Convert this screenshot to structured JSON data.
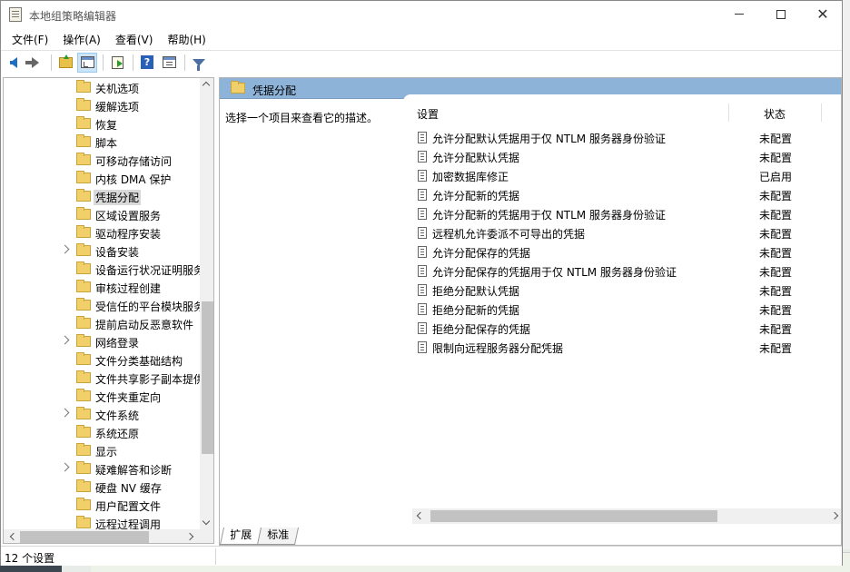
{
  "window": {
    "title": "本地组策略编辑器",
    "min_label": "—",
    "max_label": "☐",
    "close_label": "✕"
  },
  "menu": [
    "文件(F)",
    "操作(A)",
    "查看(V)",
    "帮助(H)"
  ],
  "toolbar": {
    "icons": [
      "back-arrow-icon",
      "forward-arrow-icon",
      "up-folder-icon",
      "show-tree-icon",
      "export-list-icon",
      "help-icon",
      "properties-icon",
      "filter-icon"
    ]
  },
  "tree": {
    "items": [
      {
        "label": "关机选项",
        "expandable": false
      },
      {
        "label": "缓解选项",
        "expandable": false
      },
      {
        "label": "恢复",
        "expandable": false
      },
      {
        "label": "脚本",
        "expandable": false
      },
      {
        "label": "可移动存储访问",
        "expandable": false
      },
      {
        "label": "内核 DMA 保护",
        "expandable": false
      },
      {
        "label": "凭据分配",
        "expandable": false,
        "selected": true
      },
      {
        "label": "区域设置服务",
        "expandable": false
      },
      {
        "label": "驱动程序安装",
        "expandable": false
      },
      {
        "label": "设备安装",
        "expandable": true
      },
      {
        "label": "设备运行状况证明服务",
        "expandable": false
      },
      {
        "label": "审核过程创建",
        "expandable": false
      },
      {
        "label": "受信任的平台模块服务",
        "expandable": false
      },
      {
        "label": "提前启动反恶意软件",
        "expandable": false
      },
      {
        "label": "网络登录",
        "expandable": true
      },
      {
        "label": "文件分类基础结构",
        "expandable": false
      },
      {
        "label": "文件共享影子副本提供程序",
        "expandable": false
      },
      {
        "label": "文件夹重定向",
        "expandable": false
      },
      {
        "label": "文件系统",
        "expandable": true
      },
      {
        "label": "系统还原",
        "expandable": false
      },
      {
        "label": "显示",
        "expandable": false
      },
      {
        "label": "疑难解答和诊断",
        "expandable": true
      },
      {
        "label": "硬盘 NV 缓存",
        "expandable": false
      },
      {
        "label": "用户配置文件",
        "expandable": false
      },
      {
        "label": "远程过程调用",
        "expandable": false
      }
    ]
  },
  "detail": {
    "header_title": "凭据分配",
    "description": "选择一个项目来查看它的描述。",
    "col_setting": "设置",
    "col_status": "状态",
    "rows": [
      {
        "name": "允许分配默认凭据用于仅 NTLM 服务器身份验证",
        "state": "未配置"
      },
      {
        "name": "允许分配默认凭据",
        "state": "未配置"
      },
      {
        "name": "加密数据库修正",
        "state": "已启用"
      },
      {
        "name": "允许分配新的凭据",
        "state": "未配置"
      },
      {
        "name": "允许分配新的凭据用于仅 NTLM 服务器身份验证",
        "state": "未配置"
      },
      {
        "name": "远程机允许委派不可导出的凭据",
        "state": "未配置"
      },
      {
        "name": "允许分配保存的凭据",
        "state": "未配置"
      },
      {
        "name": "允许分配保存的凭据用于仅 NTLM 服务器身份验证",
        "state": "未配置"
      },
      {
        "name": "拒绝分配默认凭据",
        "state": "未配置"
      },
      {
        "name": "拒绝分配新的凭据",
        "state": "未配置"
      },
      {
        "name": "拒绝分配保存的凭据",
        "state": "未配置"
      },
      {
        "name": "限制向远程服务器分配凭据",
        "state": "未配置"
      }
    ],
    "tabs": [
      "扩展",
      "标准"
    ]
  },
  "status": {
    "text": "12 个设置"
  },
  "colors": {
    "header_blue": "#8eb3d8",
    "selection_gray": "#d9d9d9",
    "folder_yellow": "#f1cf6b"
  }
}
